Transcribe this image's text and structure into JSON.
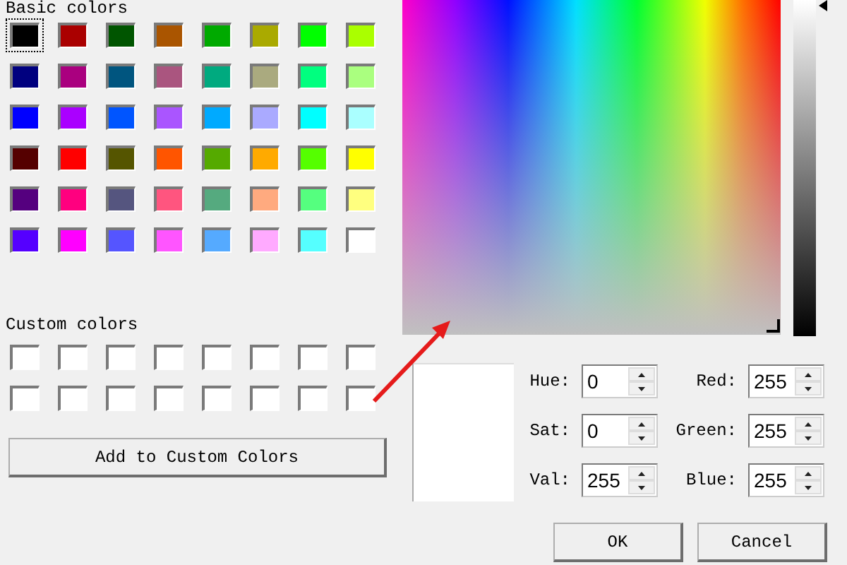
{
  "basic_colors_label": "Basic colors",
  "basic_colors": [
    {
      "color": "#000000",
      "selected": true
    },
    {
      "color": "#aa0000",
      "selected": false
    },
    {
      "color": "#005500",
      "selected": false
    },
    {
      "color": "#aa5500",
      "selected": false
    },
    {
      "color": "#00aa00",
      "selected": false
    },
    {
      "color": "#aaaa00",
      "selected": false
    },
    {
      "color": "#00ff00",
      "selected": false
    },
    {
      "color": "#aaff00",
      "selected": false
    },
    {
      "color": "#00007f",
      "selected": false
    },
    {
      "color": "#aa007f",
      "selected": false
    },
    {
      "color": "#00557f",
      "selected": false
    },
    {
      "color": "#aa557f",
      "selected": false
    },
    {
      "color": "#00aa7f",
      "selected": false
    },
    {
      "color": "#aaaa7f",
      "selected": false
    },
    {
      "color": "#00ff7f",
      "selected": false
    },
    {
      "color": "#aaff7f",
      "selected": false
    },
    {
      "color": "#0000ff",
      "selected": false
    },
    {
      "color": "#aa00ff",
      "selected": false
    },
    {
      "color": "#0055ff",
      "selected": false
    },
    {
      "color": "#aa55ff",
      "selected": false
    },
    {
      "color": "#00aaff",
      "selected": false
    },
    {
      "color": "#aaaaff",
      "selected": false
    },
    {
      "color": "#00ffff",
      "selected": false
    },
    {
      "color": "#aaffff",
      "selected": false
    },
    {
      "color": "#550000",
      "selected": false
    },
    {
      "color": "#ff0000",
      "selected": false
    },
    {
      "color": "#555500",
      "selected": false
    },
    {
      "color": "#ff5500",
      "selected": false
    },
    {
      "color": "#55aa00",
      "selected": false
    },
    {
      "color": "#ffaa00",
      "selected": false
    },
    {
      "color": "#55ff00",
      "selected": false
    },
    {
      "color": "#ffff00",
      "selected": false
    },
    {
      "color": "#55007f",
      "selected": false
    },
    {
      "color": "#ff007f",
      "selected": false
    },
    {
      "color": "#55557f",
      "selected": false
    },
    {
      "color": "#ff557f",
      "selected": false
    },
    {
      "color": "#55aa7f",
      "selected": false
    },
    {
      "color": "#ffaa7f",
      "selected": false
    },
    {
      "color": "#55ff7f",
      "selected": false
    },
    {
      "color": "#ffff7f",
      "selected": false
    },
    {
      "color": "#5500ff",
      "selected": false
    },
    {
      "color": "#ff00ff",
      "selected": false
    },
    {
      "color": "#5555ff",
      "selected": false
    },
    {
      "color": "#ff55ff",
      "selected": false
    },
    {
      "color": "#55aaff",
      "selected": false
    },
    {
      "color": "#ffaaff",
      "selected": false
    },
    {
      "color": "#55ffff",
      "selected": false
    },
    {
      "color": "#ffffff",
      "selected": false
    }
  ],
  "custom_colors_label": "Custom colors",
  "custom_colors": [
    {
      "color": "#ffffff"
    },
    {
      "color": "#ffffff"
    },
    {
      "color": "#ffffff"
    },
    {
      "color": "#ffffff"
    },
    {
      "color": "#ffffff"
    },
    {
      "color": "#ffffff"
    },
    {
      "color": "#ffffff"
    },
    {
      "color": "#ffffff"
    },
    {
      "color": "#ffffff"
    },
    {
      "color": "#ffffff"
    },
    {
      "color": "#ffffff"
    },
    {
      "color": "#ffffff"
    },
    {
      "color": "#ffffff"
    },
    {
      "color": "#ffffff"
    },
    {
      "color": "#ffffff"
    },
    {
      "color": "#ffffff"
    }
  ],
  "add_button": "Add to Custom Colors",
  "value_slider": {
    "level": 1
  },
  "preview": {
    "color": "#ffffff"
  },
  "hsv_fields": [
    {
      "label": "Hue:",
      "value": "0"
    },
    {
      "label": "Sat:",
      "value": "0"
    },
    {
      "label": "Val:",
      "value": "255"
    }
  ],
  "rgb_fields": [
    {
      "label": "Red:",
      "value": "255"
    },
    {
      "label": "Green:",
      "value": "255"
    },
    {
      "label": "Blue:",
      "value": "255"
    }
  ],
  "buttons": [
    "OK",
    "Cancel"
  ]
}
